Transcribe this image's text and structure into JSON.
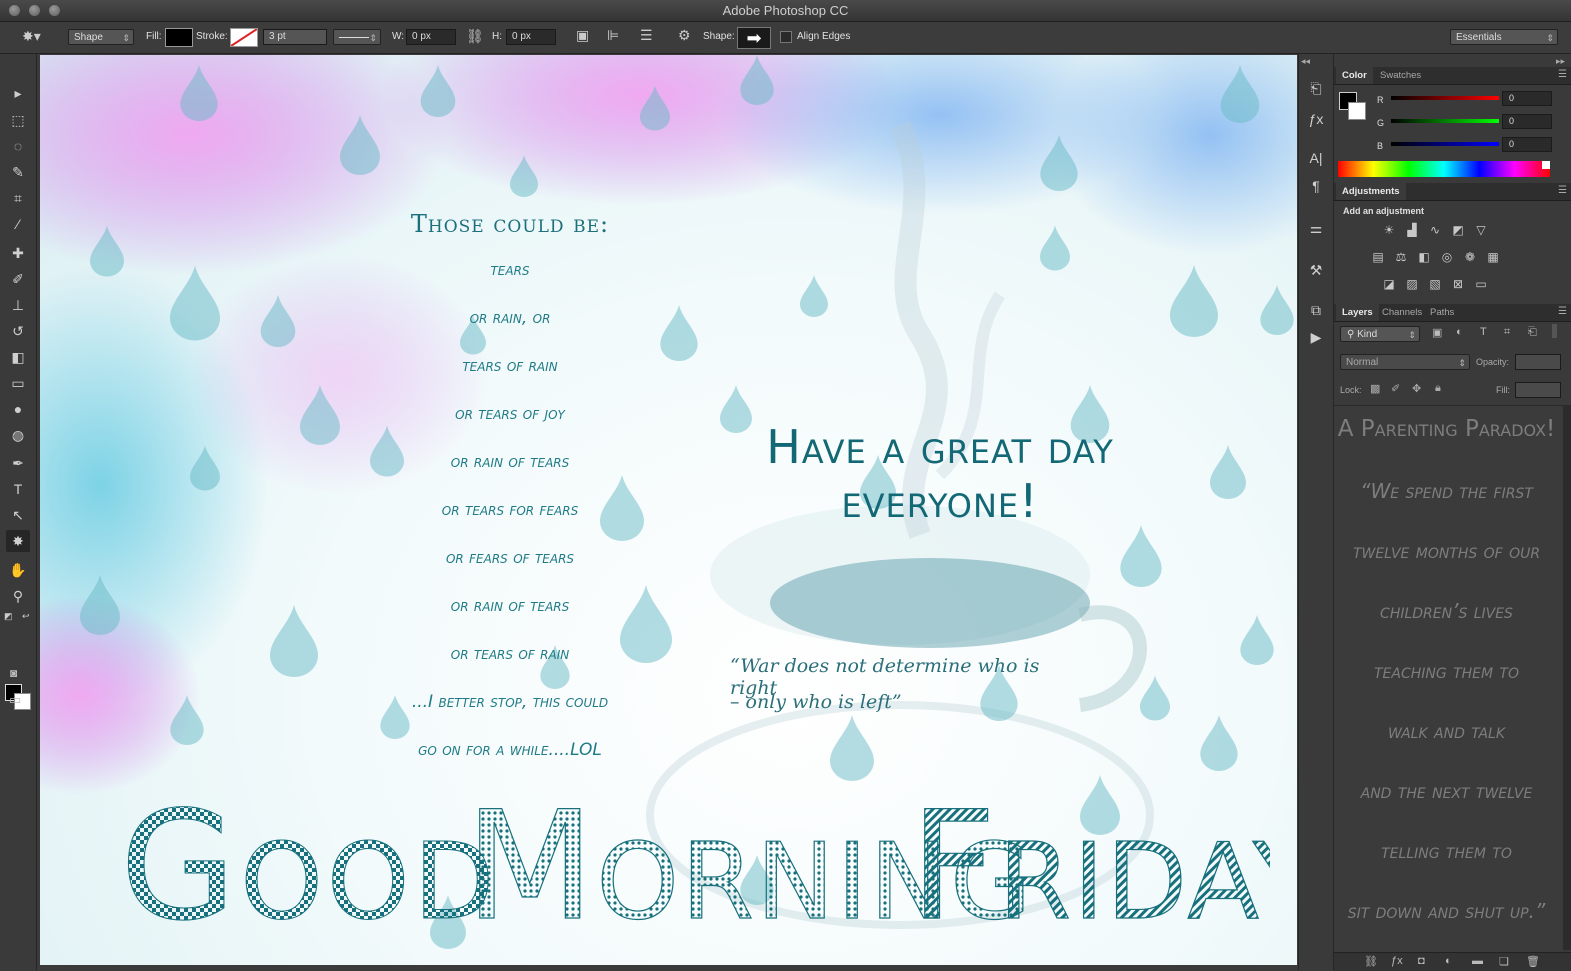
{
  "app": {
    "title": "Adobe Photoshop CC"
  },
  "options_bar": {
    "tool_mode": "Shape",
    "fill_label": "Fill:",
    "stroke_label": "Stroke:",
    "stroke_width": "3 pt",
    "w_label": "W:",
    "w_value": "0 px",
    "h_label": "H:",
    "h_value": "0 px",
    "shape_label": "Shape:",
    "align_edges_label": "Align Edges",
    "workspace": "Essentials"
  },
  "tools": [
    {
      "name": "move-tool",
      "icon": "▸"
    },
    {
      "name": "marquee-tool",
      "icon": "⬚"
    },
    {
      "name": "lasso-tool",
      "icon": "◌"
    },
    {
      "name": "quick-select-tool",
      "icon": "✎"
    },
    {
      "name": "crop-tool",
      "icon": "⌗"
    },
    {
      "name": "eyedropper-tool",
      "icon": "⁄"
    },
    {
      "name": "healing-brush-tool",
      "icon": "✚"
    },
    {
      "name": "brush-tool",
      "icon": "✐"
    },
    {
      "name": "clone-stamp-tool",
      "icon": "⊥"
    },
    {
      "name": "history-brush-tool",
      "icon": "↺"
    },
    {
      "name": "eraser-tool",
      "icon": "◧"
    },
    {
      "name": "gradient-tool",
      "icon": "▭"
    },
    {
      "name": "blur-tool",
      "icon": "●"
    },
    {
      "name": "dodge-tool",
      "icon": "◍"
    },
    {
      "name": "pen-tool",
      "icon": "✒"
    },
    {
      "name": "type-tool",
      "icon": "T"
    },
    {
      "name": "path-select-tool",
      "icon": "↖"
    },
    {
      "name": "custom-shape-tool",
      "icon": "✸"
    },
    {
      "name": "hand-tool",
      "icon": "✋"
    },
    {
      "name": "zoom-tool",
      "icon": "⚲"
    }
  ],
  "canvas": {
    "poem_title": "Those could be:",
    "poem_lines": [
      "tears",
      "or rain, or",
      "tears of rain",
      "or tears of joy",
      "or rain of tears",
      "or tears for fears",
      "or fears of tears",
      "or rain of tears",
      "or tears of rain",
      "...I better stop, this could",
      "go on for a while....LOL"
    ],
    "greeting": "Have a great day everyone!",
    "quote_line1": "“War does not determine who is right",
    "quote_line2": "– only who is left”",
    "headline_words": [
      "Good",
      "Morning",
      "Friday!"
    ]
  },
  "color_panel": {
    "tabs": [
      "Color",
      "Swatches"
    ],
    "r_label": "R",
    "r_value": "0",
    "g_label": "G",
    "g_value": "0",
    "b_label": "B",
    "b_value": "0"
  },
  "adjustments_panel": {
    "tab": "Adjustments",
    "hint": "Add an adjustment"
  },
  "layers_panel": {
    "tabs": [
      "Layers",
      "Channels",
      "Paths"
    ],
    "filter_kind": "Kind",
    "blend_mode": "Normal",
    "opacity_label": "Opacity:",
    "lock_label": "Lock:",
    "fill_label": "Fill:",
    "content_lines": [
      "A Parenting Paradox!",
      "“We spend the first",
      "twelve months of our",
      "children’s lives",
      "teaching them to",
      "walk and talk",
      "and the next twelve",
      "telling them to",
      "sit down and shut up.”"
    ]
  },
  "colors": {
    "teal_text": "#1e6f7c",
    "drop_fill": "#7fc6cf",
    "petal_pink": "#e07ae6",
    "petal_purple": "#9a7ff0"
  }
}
